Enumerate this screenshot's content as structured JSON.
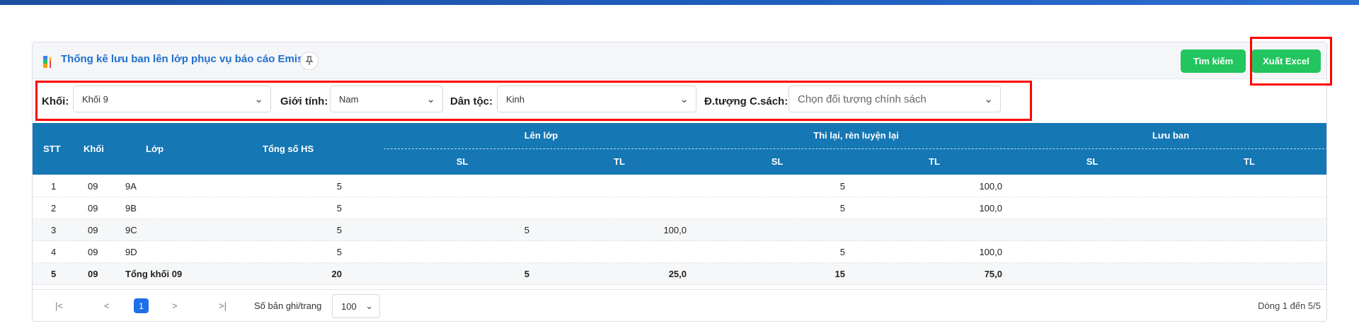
{
  "panel": {
    "title": "Thống kê lưu ban lên lớp phục vụ báo cáo Emis",
    "pin_icon": "pin-icon",
    "search_button": "Tìm kiếm",
    "excel_button": "Xuất Excel",
    "accent_color": "#22c55e",
    "header_color": "#1577b4"
  },
  "filters": {
    "khoi": {
      "label": "Khối:",
      "value": "Khối 9"
    },
    "gioitinh": {
      "label": "Giới tính:",
      "value": "Nam"
    },
    "dantoc": {
      "label": "Dân tộc:",
      "value": "Kinh"
    },
    "chinhsach": {
      "label": "Đ.tượng C.sách:",
      "placeholder": "Chọn đối tượng chính sách"
    }
  },
  "table": {
    "headers": {
      "stt": "STT",
      "khoi": "Khối",
      "lop": "Lớp",
      "tong": "Tổng số HS",
      "lenlop": "Lên lớp",
      "thilai": "Thi lại, rèn luyện lại",
      "luuban": "Lưu ban",
      "sl": "SL",
      "tl": "TL"
    },
    "rows": [
      {
        "stt": "1",
        "khoi": "09",
        "lop": "9A",
        "tong": "5",
        "len_sl": "",
        "len_tl": "",
        "thi_sl": "5",
        "thi_tl": "100,0",
        "luu_sl": "",
        "luu_tl": ""
      },
      {
        "stt": "2",
        "khoi": "09",
        "lop": "9B",
        "tong": "5",
        "len_sl": "",
        "len_tl": "",
        "thi_sl": "5",
        "thi_tl": "100,0",
        "luu_sl": "",
        "luu_tl": ""
      },
      {
        "stt": "3",
        "khoi": "09",
        "lop": "9C",
        "tong": "5",
        "len_sl": "5",
        "len_tl": "100,0",
        "thi_sl": "",
        "thi_tl": "",
        "luu_sl": "",
        "luu_tl": ""
      },
      {
        "stt": "4",
        "khoi": "09",
        "lop": "9D",
        "tong": "5",
        "len_sl": "",
        "len_tl": "",
        "thi_sl": "5",
        "thi_tl": "100,0",
        "luu_sl": "",
        "luu_tl": ""
      },
      {
        "stt": "5",
        "khoi": "09",
        "lop": "Tổng khối 09",
        "tong": "20",
        "len_sl": "5",
        "len_tl": "25,0",
        "thi_sl": "15",
        "thi_tl": "75,0",
        "luu_sl": "",
        "luu_tl": ""
      }
    ]
  },
  "pager": {
    "first": "|<",
    "prev": "<",
    "current": "1",
    "next": ">",
    "last": ">|",
    "size_label": "Số bản ghi/trang",
    "size_value": "100",
    "info": "Dòng 1 đến 5/5"
  }
}
